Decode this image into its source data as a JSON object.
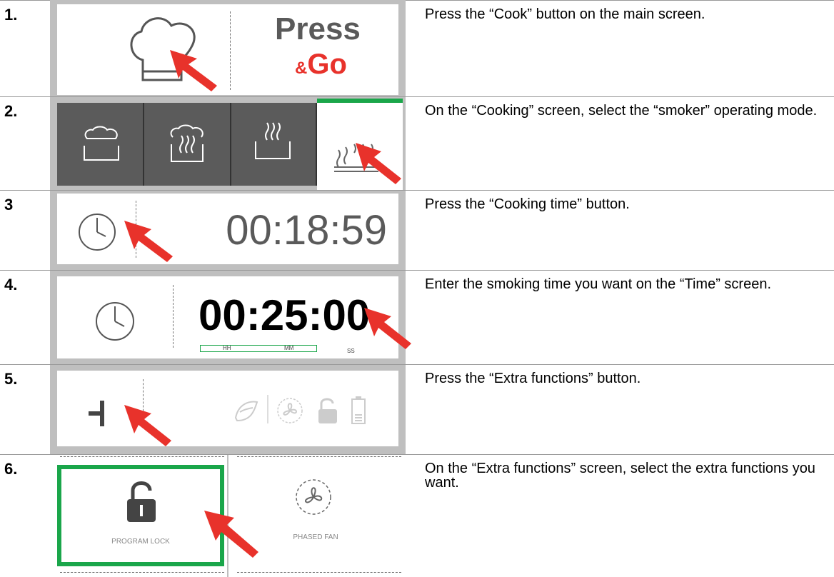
{
  "steps": [
    {
      "num": "1.",
      "text": "Press the “Cook” button on the main screen."
    },
    {
      "num": "2.",
      "text": "On the “Cooking” screen, select the “smoker” operating mode."
    },
    {
      "num": "3",
      "text": "Press the “Cooking time” button."
    },
    {
      "num": "4.",
      "text": "Enter the smoking time you want on the “Time” screen."
    },
    {
      "num": "5.",
      "text": "Press the “Extra functions” button."
    },
    {
      "num": "6.",
      "text": "On the “Extra functions” screen, select the extra functions you want."
    }
  ],
  "screens": {
    "press_go": {
      "line1": "Press",
      "amp": "&",
      "line2": "Go"
    },
    "cooking_time": {
      "value": "00:18:59"
    },
    "time_entry": {
      "value": "00:25:00",
      "labels": [
        "HH",
        "MM",
        "SS"
      ]
    },
    "extra": {
      "program_lock": "PROGRAM LOCK",
      "phased_fan": "PHASED FAN"
    }
  },
  "colors": {
    "accent_green": "#1aa64a",
    "arrow_red": "#e8322b",
    "dark_panel": "#5b5b5b"
  },
  "icons": [
    "chef-hat-icon",
    "cloud-steam-icon",
    "steam-hot-icon",
    "steam-lines-icon",
    "smoker-icon",
    "clock-icon",
    "extra-functions-icon",
    "drying-icon",
    "fan-icon",
    "lock-icon",
    "battery-icon",
    "red-arrow-icon"
  ]
}
